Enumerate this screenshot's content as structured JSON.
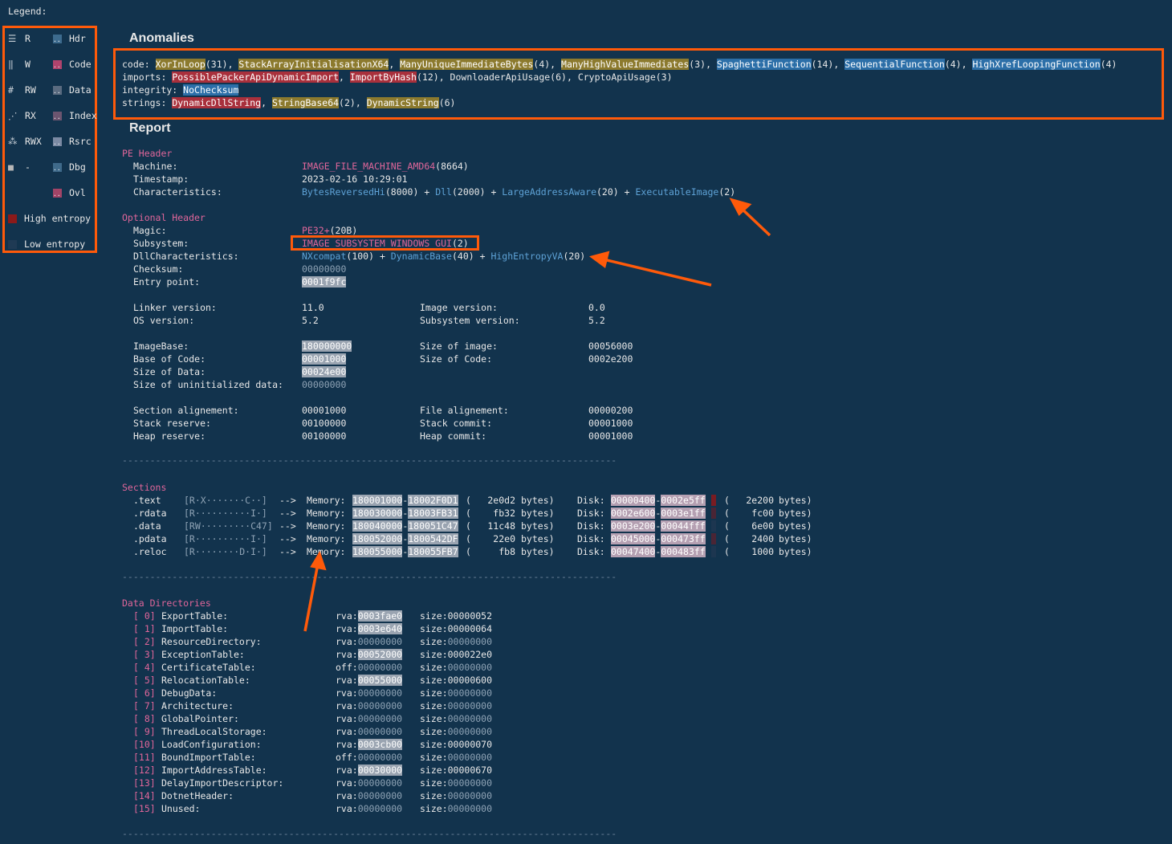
{
  "legend": {
    "title": "Legend:",
    "perm": [
      {
        "label": "R",
        "glyph": "☰"
      },
      {
        "label": "W",
        "glyph": "‖"
      },
      {
        "label": "RW",
        "glyph": "#"
      },
      {
        "label": "RX",
        "glyph": "⋰"
      },
      {
        "label": "RWX",
        "glyph": "⁂"
      },
      {
        "label": "-",
        "glyph": "■"
      }
    ],
    "kind": [
      {
        "label": "Hdr",
        "color": "#3d6b8e"
      },
      {
        "label": "Code",
        "color": "#b0436d"
      },
      {
        "label": "Data",
        "color": "#5a6b80"
      },
      {
        "label": "Index",
        "color": "#6c5570"
      },
      {
        "label": "Rsrc",
        "color": "#7b8aa3"
      },
      {
        "label": "Dbg",
        "color": "#3f6a8a"
      },
      {
        "label": "Ovl",
        "color": "#a24467"
      }
    ],
    "high_entropy": "High entropy",
    "low_entropy": "Low entropy",
    "colors": {
      "high": "#8b1a1a",
      "low": "#1f3a54"
    }
  },
  "anomalies": {
    "title": "Anomalies",
    "code_label": "code: ",
    "code": [
      {
        "name": "XorInLoop",
        "count": "(31)",
        "style": "y"
      },
      {
        "name": "StackArrayInitialisationX64",
        "count": "",
        "style": "y"
      },
      {
        "name": "ManyUniqueImmediateBytes",
        "count": "(4)",
        "style": "y"
      },
      {
        "name": "ManyHighValueImmediates",
        "count": "(3)",
        "style": "y"
      },
      {
        "name": "SpaghettiFunction",
        "count": "(14)",
        "style": "b"
      },
      {
        "name": "SequentialFunction",
        "count": "(4)",
        "style": "b"
      },
      {
        "name": "HighXrefLoopingFunction",
        "count": "(4)",
        "style": "b"
      }
    ],
    "imports_label": "imports: ",
    "imports": [
      {
        "name": "PossiblePackerApiDynamicImport",
        "count": "",
        "style": "r"
      },
      {
        "name": "ImportByHash",
        "count": "(12)",
        "style": "r"
      },
      {
        "name": "DownloaderApiUsage",
        "count": "(6)",
        "style": ""
      },
      {
        "name": "CryptoApiUsage",
        "count": "(3)",
        "style": ""
      }
    ],
    "integrity_label": "integrity: ",
    "integrity": [
      {
        "name": "NoChecksum",
        "count": "",
        "style": "b"
      }
    ],
    "strings_label": "strings: ",
    "strings": [
      {
        "name": "DynamicDllString",
        "count": "",
        "style": "r"
      },
      {
        "name": "StringBase64",
        "count": "(2)",
        "style": "y"
      },
      {
        "name": "DynamicString",
        "count": "(6)",
        "style": "y"
      }
    ]
  },
  "report": {
    "title": "Report",
    "pe_header": {
      "title": "PE Header",
      "machine_label": "Machine:",
      "machine_val": "IMAGE_FILE_MACHINE_AMD64",
      "machine_num": "(8664)",
      "timestamp_label": "Timestamp:",
      "timestamp_val": "2023-02-16 10:29:01",
      "char_label": "Characteristics:",
      "char_parts": [
        {
          "name": "BytesReversedHi",
          "num": "(8000)"
        },
        {
          "name": "Dll",
          "num": "(2000)"
        },
        {
          "name": "LargeAddressAware",
          "num": "(20)"
        },
        {
          "name": "ExecutableImage",
          "num": "(2)"
        }
      ],
      "plus": " + "
    },
    "optional_header": {
      "title": "Optional Header",
      "magic_label": "Magic:",
      "magic_val": "PE32+",
      "magic_num": "(20B)",
      "subsystem_label": "Subsystem:",
      "subsystem_val": "IMAGE_SUBSYSTEM_WINDOWS_GUI",
      "subsystem_num": "(2)",
      "dll_label": "DllCharacteristics:",
      "dll_parts": [
        {
          "name": "NXcompat",
          "num": "(100)"
        },
        {
          "name": "DynamicBase",
          "num": "(40)"
        },
        {
          "name": "HighEntropyVA",
          "num": "(20)"
        }
      ],
      "checksum_label": "Checksum:",
      "checksum_val": "00000000",
      "entry_label": "Entry point:",
      "entry_val": "0001f9fc",
      "linker_label": "Linker version:",
      "linker_val": "11.0",
      "imgver_label": "Image version:",
      "imgver_val": "0.0",
      "os_label": "OS version:",
      "os_val": "5.2",
      "subver_label": "Subsystem version:",
      "subver_val": "5.2",
      "imagebase_label": "ImageBase:",
      "imagebase_val": "180000000",
      "sizeimg_label": "Size of image:",
      "sizeimg_val": "00056000",
      "basecode_label": "Base of Code:",
      "basecode_val": "00001000",
      "sizecode_label": "Size of Code:",
      "sizecode_val": "0002e200",
      "sizedata_label": "Size of Data:",
      "sizedata_val": "00024e00",
      "sizeuninit_label": "Size of uninitialized data:",
      "sizeuninit_val": "00000000",
      "secalign_label": "Section alignement:",
      "secalign_val": "00001000",
      "filealign_label": "File alignement:",
      "filealign_val": "00000200",
      "stackres_label": "Stack reserve:",
      "stackres_val": "00100000",
      "stackcom_label": "Stack commit:",
      "stackcom_val": "00001000",
      "heapres_label": "Heap reserve:",
      "heapres_val": "00100000",
      "heapcom_label": "Heap commit:",
      "heapcom_val": "00001000"
    },
    "separator": "-----------------------------------------------------------------------------------------",
    "sections": {
      "title": "Sections",
      "arrow": "-->",
      "mem_label": "Memory:",
      "disk_label": "Disk:",
      "bytes_label": "bytes)",
      "rows": [
        {
          "name": ".text",
          "flags": "[R·X·······C··]",
          "mem_start": "180001000",
          "mem_end": "18002F0D1",
          "mem_size": "2e0d2",
          "disk_start": "00000400",
          "disk_end": "0002e5ff",
          "disk_size": "2e200",
          "entropy": "high"
        },
        {
          "name": ".rdata",
          "flags": "[R··········I·]",
          "mem_start": "180030000",
          "mem_end": "18003FB31",
          "mem_size": "fb32",
          "disk_start": "0002e600",
          "disk_end": "0003e1ff",
          "disk_size": "fc00",
          "entropy": "mid"
        },
        {
          "name": ".data",
          "flags": "[RW·········C47]",
          "mem_start": "180040000",
          "mem_end": "180051C47",
          "mem_size": "11c48",
          "disk_start": "0003e200",
          "disk_end": "00044fff",
          "disk_size": "6e00",
          "entropy": "low"
        },
        {
          "name": ".pdata",
          "flags": "[R··········I·]",
          "mem_start": "180052000",
          "mem_end": "1800542DF",
          "mem_size": "22e0",
          "disk_start": "00045000",
          "disk_end": "000473ff",
          "disk_size": "2400",
          "entropy": "mid"
        },
        {
          "name": ".reloc",
          "flags": "[R········D·I·]",
          "mem_start": "180055000",
          "mem_end": "180055FB7",
          "mem_size": "fb8",
          "disk_start": "00047400",
          "disk_end": "000483ff",
          "disk_size": "1000",
          "entropy": "low"
        }
      ]
    },
    "data_directories": {
      "title": "Data Directories",
      "size_label": "size:",
      "rows": [
        {
          "idx": "[ 0]",
          "name": "ExportTable:",
          "kind": "rva:",
          "addr": "0003fae0",
          "hl": true,
          "size": "00000052"
        },
        {
          "idx": "[ 1]",
          "name": "ImportTable:",
          "kind": "rva:",
          "addr": "0003e640",
          "hl": true,
          "size": "00000064"
        },
        {
          "idx": "[ 2]",
          "name": "ResourceDirectory:",
          "kind": "rva:",
          "addr": "00000000",
          "hl": false,
          "size": "00000000"
        },
        {
          "idx": "[ 3]",
          "name": "ExceptionTable:",
          "kind": "rva:",
          "addr": "00052000",
          "hl": true,
          "size": "000022e0"
        },
        {
          "idx": "[ 4]",
          "name": "CertificateTable:",
          "kind": "off:",
          "addr": "00000000",
          "hl": false,
          "size": "00000000"
        },
        {
          "idx": "[ 5]",
          "name": "RelocationTable:",
          "kind": "rva:",
          "addr": "00055000",
          "hl": true,
          "size": "00000600"
        },
        {
          "idx": "[ 6]",
          "name": "DebugData:",
          "kind": "rva:",
          "addr": "00000000",
          "hl": false,
          "size": "00000000"
        },
        {
          "idx": "[ 7]",
          "name": "Architecture:",
          "kind": "rva:",
          "addr": "00000000",
          "hl": false,
          "size": "00000000"
        },
        {
          "idx": "[ 8]",
          "name": "GlobalPointer:",
          "kind": "rva:",
          "addr": "00000000",
          "hl": false,
          "size": "00000000"
        },
        {
          "idx": "[ 9]",
          "name": "ThreadLocalStorage:",
          "kind": "rva:",
          "addr": "00000000",
          "hl": false,
          "size": "00000000"
        },
        {
          "idx": "[10]",
          "name": "LoadConfiguration:",
          "kind": "rva:",
          "addr": "0003cb00",
          "hl": true,
          "size": "00000070"
        },
        {
          "idx": "[11]",
          "name": "BoundImportTable:",
          "kind": "off:",
          "addr": "00000000",
          "hl": false,
          "size": "00000000"
        },
        {
          "idx": "[12]",
          "name": "ImportAddressTable:",
          "kind": "rva:",
          "addr": "00030000",
          "hl": true,
          "size": "00000670"
        },
        {
          "idx": "[13]",
          "name": "DelayImportDescriptor:",
          "kind": "rva:",
          "addr": "00000000",
          "hl": false,
          "size": "00000000"
        },
        {
          "idx": "[14]",
          "name": "DotnetHeader:",
          "kind": "rva:",
          "addr": "00000000",
          "hl": false,
          "size": "00000000"
        },
        {
          "idx": "[15]",
          "name": "Unused:",
          "kind": "rva:",
          "addr": "00000000",
          "hl": false,
          "size": "00000000"
        }
      ]
    }
  }
}
